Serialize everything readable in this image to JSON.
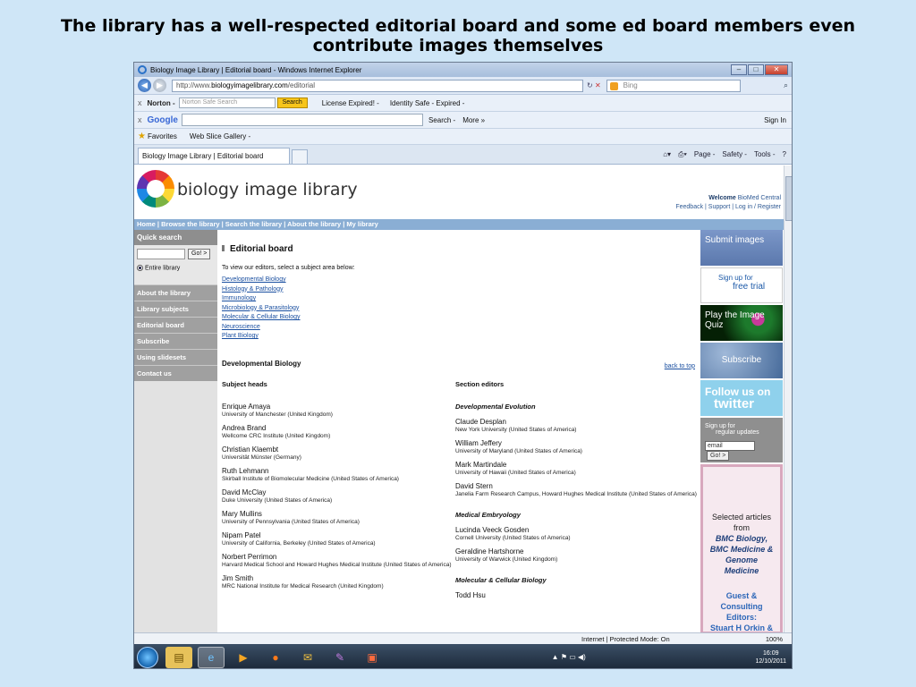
{
  "slide": {
    "title": "The library has a well-respected editorial board and some ed board members even contribute images themselves"
  },
  "browser": {
    "window_title": "Biology Image Library | Editorial board - Windows Internet Explorer",
    "url_prefix": "http://www.",
    "url_domain": "biologyimagelibrary.com",
    "url_path": "/editorial",
    "search_placeholder": "Bing",
    "norton": {
      "label": "Norton -",
      "search_placeholder": "Norton Safe Search",
      "search_button": "Search",
      "license": "License Expired! -",
      "identity": "Identity Safe - Expired -"
    },
    "google": {
      "label": "Google",
      "search": "Search -",
      "more": "More »",
      "signin": "Sign In"
    },
    "favorites": "Favorites",
    "web_slice": "Web Slice Gallery -",
    "tab_title": "Biology Image Library | Editorial board",
    "commands": [
      "Page -",
      "Safety -",
      "Tools -"
    ],
    "status_zone": "Internet | Protected Mode: On",
    "zoom": "100%"
  },
  "site": {
    "name": "biology image library",
    "welcome_label": "Welcome",
    "welcome_user": "BioMed Central",
    "top_links": "Feedback | Support | Log in / Register",
    "nav": "Home | Browse the library | Search the library | About the library | My library",
    "quick_search_title": "Quick search",
    "go_label": "Go!",
    "entire_library": "Entire library",
    "left_nav": [
      "About the library",
      "Library subjects",
      "Editorial board",
      "Subscribe",
      "Using slidesets",
      "Contact us"
    ]
  },
  "content": {
    "heading": "Editorial board",
    "intro": "To view our editors, select a subject area below:",
    "subjects": [
      "Developmental Biology",
      "Histology & Pathology",
      "Immunology",
      "Microbiology & Parasitology",
      "Molecular & Cellular Biology",
      "Neuroscience",
      "Plant Biology"
    ],
    "section_title": "Developmental Biology",
    "back_to_top": "back to top",
    "subject_heads_label": "Subject heads",
    "section_editors_label": "Section editors",
    "subject_heads": [
      {
        "name": "Enrique Amaya",
        "aff": "University of Manchester  (United Kingdom)"
      },
      {
        "name": "Andrea Brand",
        "aff": "Wellcome CRC Institute  (United Kingdom)"
      },
      {
        "name": "Christian Klaembt",
        "aff": "Universität Münster  (Germany)"
      },
      {
        "name": "Ruth Lehmann",
        "aff": "Skirball Institute of Biomolecular Medicine  (United States of America)"
      },
      {
        "name": "David McClay",
        "aff": "Duke University  (United States of America)"
      },
      {
        "name": "Mary Mullins",
        "aff": "University of Pennsylvania  (United States of America)"
      },
      {
        "name": "Nipam Patel",
        "aff": "University of California, Berkeley  (United States of America)"
      },
      {
        "name": "Norbert Perrimon",
        "aff": "Harvard Medical School and Howard Hughes Medical Institute  (United States of America)"
      },
      {
        "name": "Jim Smith",
        "aff": "MRC National Institute for Medical Research  (United Kingdom)"
      }
    ],
    "editor_groups": [
      {
        "group": "Developmental Evolution",
        "people": [
          {
            "name": "Claude Desplan",
            "aff": "New York University  (United States of America)"
          },
          {
            "name": "William Jeffery",
            "aff": "University of Maryland  (United States of America)"
          },
          {
            "name": "Mark Martindale",
            "aff": "University of Hawaii  (United States of America)"
          },
          {
            "name": "David Stern",
            "aff": "Janelia Farm Research Campus, Howard Hughes Medical Institute  (United States of America)"
          }
        ]
      },
      {
        "group": "Medical Embryology",
        "people": [
          {
            "name": "Lucinda Veeck Gosden",
            "aff": "Cornell University  (United States of America)"
          },
          {
            "name": "Geraldine Hartshorne",
            "aff": "University of Warwick  (United Kingdom)"
          }
        ]
      },
      {
        "group": "Molecular & Cellular Biology",
        "people": [
          {
            "name": "Todd Hsu",
            "aff": ""
          }
        ]
      }
    ]
  },
  "sidebar": {
    "submit": "Submit images",
    "trial_1": "Sign up for",
    "trial_2": "free trial",
    "quiz": "Play the Image Quiz",
    "subscribe": "Subscribe",
    "follow": "Follow us on",
    "twitter": "twitter",
    "signup_1": "Sign up for",
    "signup_2": "regular updates",
    "email_value": "email",
    "go": "Go!",
    "articles": "Selected articles from",
    "journals": "BMC Biology, BMC Medicine & Genome Medicine",
    "guest": "Guest & Consulting Editors:",
    "guest_names": "Stuart H Orkin & Arthur D Lander"
  },
  "taskbar": {
    "time": "16:09",
    "date": "12/10/2011"
  }
}
